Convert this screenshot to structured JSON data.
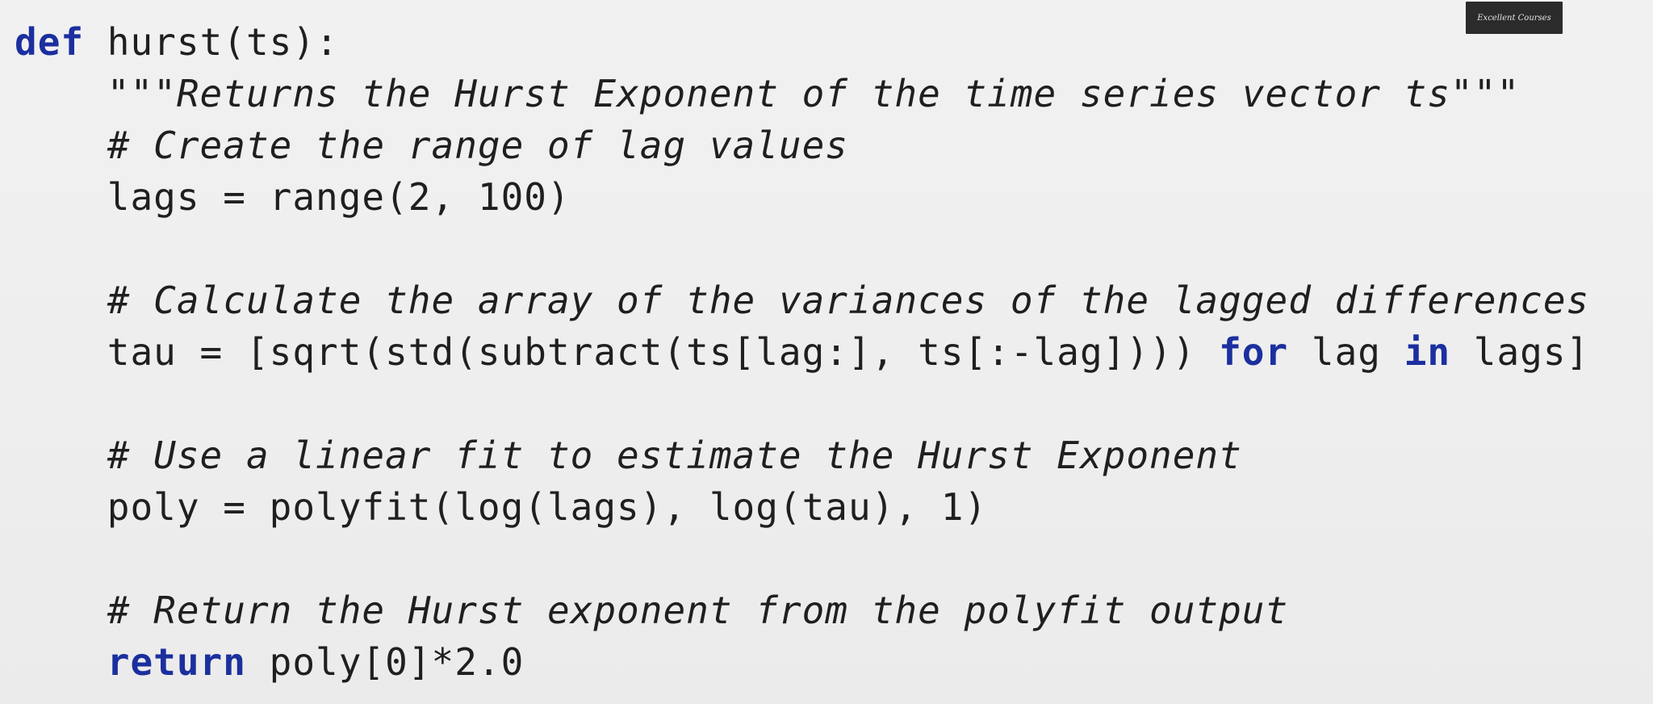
{
  "code": {
    "lines": [
      {
        "kind": "def",
        "keyword": "def",
        "text": " hurst(ts):"
      },
      {
        "kind": "docstring",
        "indent": "    ",
        "text": "\"\"\"Returns the Hurst Exponent of the time series vector ts\"\"\""
      },
      {
        "kind": "comment",
        "indent": "    ",
        "text": "# Create the range of lag values"
      },
      {
        "kind": "code",
        "indent": "    ",
        "text": "lags = range(2, 100)"
      },
      {
        "kind": "blank",
        "text": ""
      },
      {
        "kind": "comment",
        "indent": "    ",
        "text": "# Calculate the array of the variances of the lagged differences"
      },
      {
        "kind": "mixed",
        "indent": "    ",
        "text_1": "tau = [sqrt(std(subtract(ts[lag:], ts[:-lag]))) ",
        "keyword_1": "for",
        "text_2": " lag ",
        "keyword_2": "in",
        "text_3": " lags]"
      },
      {
        "kind": "blank",
        "text": ""
      },
      {
        "kind": "comment",
        "indent": "    ",
        "text": "# Use a linear fit to estimate the Hurst Exponent"
      },
      {
        "kind": "code",
        "indent": "    ",
        "text": "poly = polyfit(log(lags), log(tau), 1)"
      },
      {
        "kind": "blank",
        "text": ""
      },
      {
        "kind": "comment",
        "indent": "    ",
        "text": "# Return the Hurst exponent from the polyfit output"
      },
      {
        "kind": "return",
        "indent": "    ",
        "keyword": "return",
        "text": " poly[0]*2.0"
      }
    ]
  },
  "watermark": {
    "text": "Excellent Courses"
  },
  "colors": {
    "background": "#efefef",
    "keyword": "#1b2f9e",
    "text": "#1f1f1f",
    "badge": "#2b2b2b"
  }
}
